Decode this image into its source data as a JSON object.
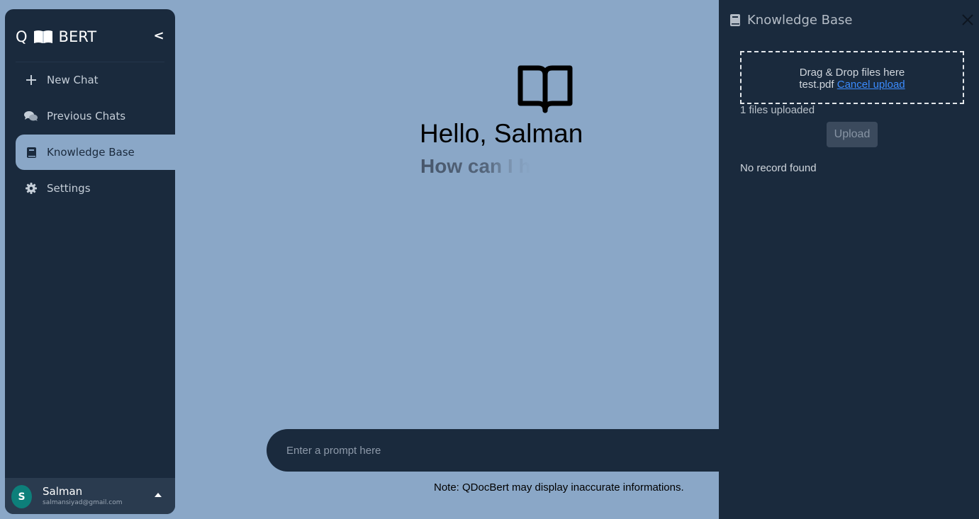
{
  "brand": {
    "prefix": "Q",
    "suffix": "BERT",
    "collapse_label": "<"
  },
  "sidebar": {
    "items": [
      {
        "label": "New Chat",
        "icon": "plus-icon"
      },
      {
        "label": "Previous Chats",
        "icon": "chat-bubbles-icon"
      },
      {
        "label": "Knowledge Base",
        "icon": "book-icon",
        "active": true
      },
      {
        "label": "Settings",
        "icon": "gear-icon"
      }
    ]
  },
  "user": {
    "initial": "S",
    "name": "Salman",
    "email": "salmansiyad@gmail.com"
  },
  "main": {
    "greeting": "Hello, Salman",
    "subgreeting": "How can I h",
    "prompt_placeholder": "Enter a prompt here",
    "note": "Note: QDocBert may display inaccurate informations."
  },
  "knowledge_base": {
    "title": "Knowledge Base",
    "drop_text": "Drag & Drop files here",
    "file_name": "test.pdf",
    "cancel_label": "Cancel upload",
    "files_uploaded": "1 files uploaded",
    "upload_label": "Upload",
    "empty_message": "No record found"
  },
  "colors": {
    "sidebar_bg": "#1a2a3d",
    "main_bg": "#8aa7c7",
    "avatar_bg": "#0d7f7a",
    "link": "#3b8cff"
  }
}
